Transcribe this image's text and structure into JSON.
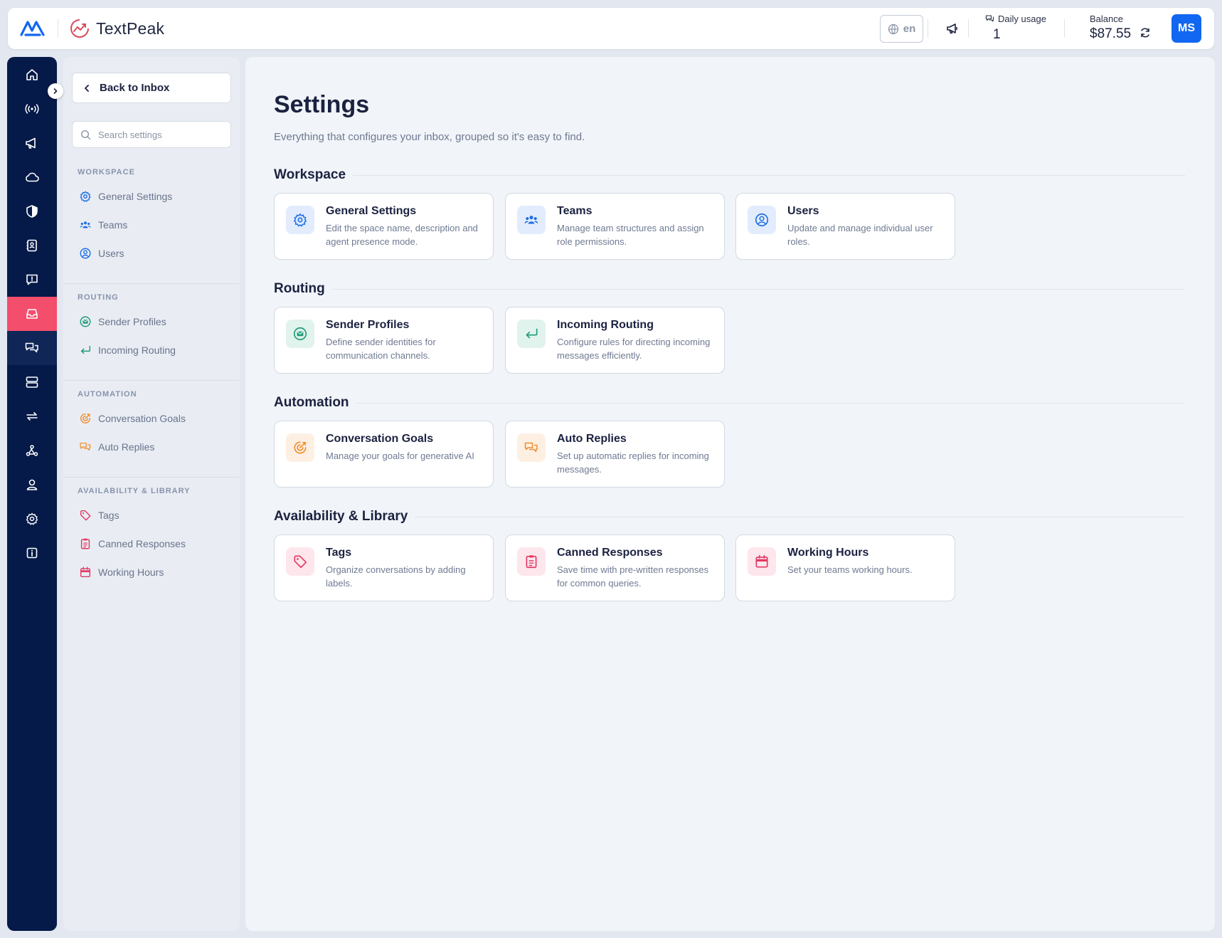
{
  "brand": {
    "name": "TextPeak"
  },
  "header": {
    "language": "en",
    "usage_label": "Daily usage",
    "usage_value": "1",
    "balance_label": "Balance",
    "balance_value": "$87.55",
    "avatar_initials": "MS"
  },
  "rail": {
    "items": [
      {
        "icon": "home-icon"
      },
      {
        "icon": "broadcast-icon"
      },
      {
        "icon": "megaphone-icon"
      },
      {
        "icon": "cloud-icon"
      },
      {
        "icon": "shield-icon"
      },
      {
        "icon": "contacts-icon"
      },
      {
        "icon": "chat-alert-icon"
      },
      {
        "icon": "inbox-icon",
        "state": "active"
      },
      {
        "icon": "conversations-icon",
        "state": "hover"
      },
      {
        "icon": "server-icon"
      },
      {
        "icon": "exchange-icon"
      },
      {
        "icon": "webhook-icon"
      },
      {
        "icon": "user-icon"
      },
      {
        "icon": "settings-icon"
      },
      {
        "icon": "info-icon"
      }
    ]
  },
  "sidebar": {
    "back_label": "Back to Inbox",
    "search_placeholder": "Search settings",
    "groups": [
      {
        "title": "WORKSPACE",
        "items": [
          "General Settings",
          "Teams",
          "Users"
        ]
      },
      {
        "title": "ROUTING",
        "items": [
          "Sender Profiles",
          "Incoming Routing"
        ]
      },
      {
        "title": "AUTOMATION",
        "items": [
          "Conversation Goals",
          "Auto Replies"
        ]
      },
      {
        "title": "AVAILABILITY & LIBRARY",
        "items": [
          "Tags",
          "Canned Responses",
          "Working Hours"
        ]
      }
    ]
  },
  "main": {
    "title": "Settings",
    "subtitle": "Everything that configures your inbox, grouped so it's easy to find.",
    "sections": [
      {
        "title": "Workspace",
        "cards": [
          {
            "title": "General Settings",
            "desc": "Edit the space name, description and agent presence mode."
          },
          {
            "title": "Teams",
            "desc": "Manage team structures and assign role permissions."
          },
          {
            "title": "Users",
            "desc": "Update and manage individual user roles."
          }
        ]
      },
      {
        "title": "Routing",
        "cards": [
          {
            "title": "Sender Profiles",
            "desc": "Define sender identities for communication channels."
          },
          {
            "title": "Incoming Routing",
            "desc": "Configure rules for directing incoming messages efficiently."
          }
        ]
      },
      {
        "title": "Automation",
        "cards": [
          {
            "title": "Conversation Goals",
            "desc": "Manage your goals for generative AI"
          },
          {
            "title": "Auto Replies",
            "desc": "Set up automatic replies for incoming messages."
          }
        ]
      },
      {
        "title": "Availability & Library",
        "cards": [
          {
            "title": "Tags",
            "desc": "Organize conversations by adding labels."
          },
          {
            "title": "Canned Responses",
            "desc": "Save time with pre-written responses for common queries."
          },
          {
            "title": "Working Hours",
            "desc": "Set your teams working hours."
          }
        ]
      }
    ]
  },
  "colors": {
    "rail_bg": "#051a48",
    "rail_active": "#f34e6b",
    "primary": "#1267f2",
    "workspace_accent": "#1f6fe5",
    "routing_accent": "#1e9c78",
    "automation_accent": "#f08d2b",
    "library_accent": "#e23a64"
  }
}
